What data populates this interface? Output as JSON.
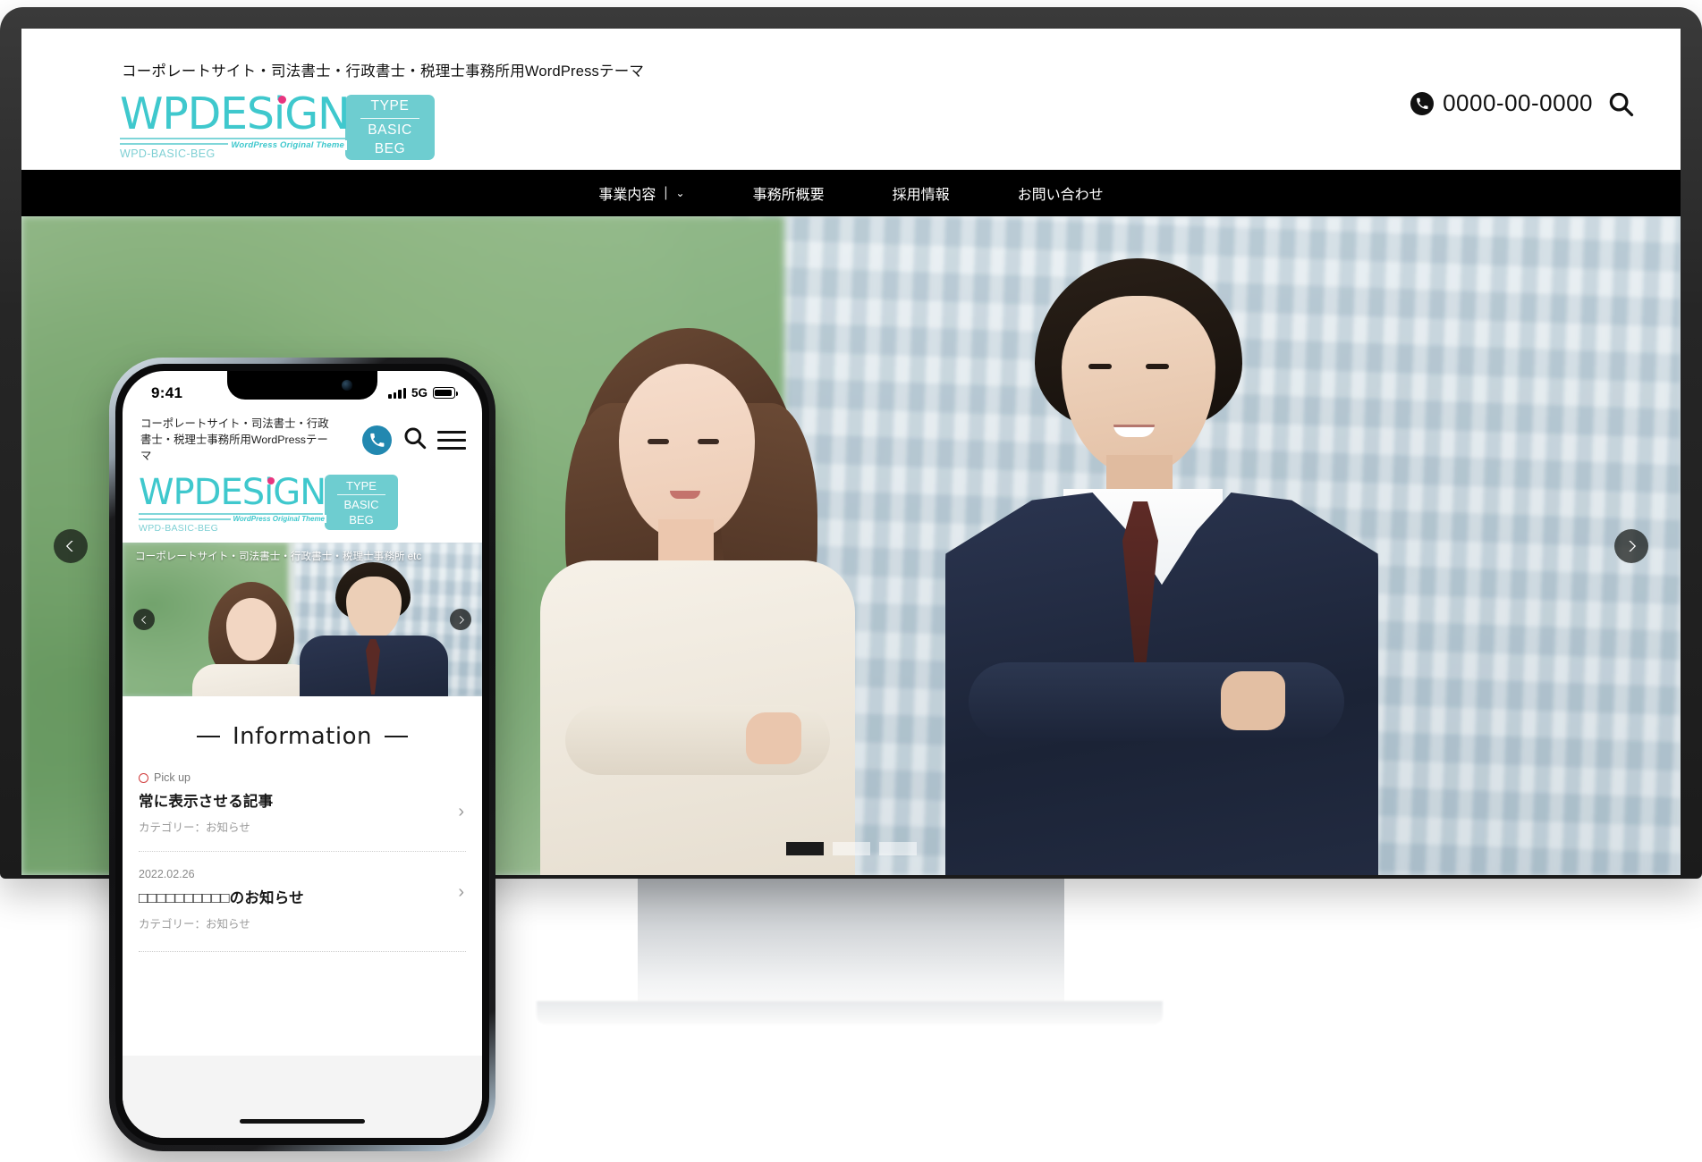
{
  "desktop": {
    "tagline": "コーポレートサイト・司法書士・行政書士・税理士事務所用WordPressテーマ",
    "logo": {
      "word_a": "WPDES",
      "word_i": "i",
      "word_b": "GN",
      "sub": "WordPress Original Theme",
      "code": "WPD-BASIC-BEG",
      "badge_type": "TYPE",
      "badge_basic": "BASIC",
      "badge_beg": "BEG"
    },
    "header": {
      "phone": "0000-00-0000",
      "phone_icon": "phone-icon",
      "search_icon": "search-icon"
    },
    "nav": [
      {
        "label": "事業内容",
        "separator": "|",
        "chevron": "⌄",
        "has_submenu": true
      },
      {
        "label": "事務所概要",
        "has_submenu": false
      },
      {
        "label": "採用情報",
        "has_submenu": false
      },
      {
        "label": "お問い合わせ",
        "has_submenu": false
      }
    ],
    "hero": {
      "prev_icon": "chevron-left-icon",
      "next_icon": "chevron-right-icon",
      "slides": 3,
      "active_slide": 1
    }
  },
  "mobile": {
    "status": {
      "time": "9:41",
      "network": "5G",
      "signal_icon": "signal-bars-icon",
      "battery_icon": "battery-icon"
    },
    "header": {
      "title": "コーポレートサイト・司法書士・行政書士・税理士事務所用WordPressテーマ",
      "phone_icon": "phone-icon",
      "search_icon": "search-icon",
      "menu_icon": "hamburger-menu-icon"
    },
    "logo": {
      "word_a": "WPDES",
      "word_i": "i",
      "word_b": "GN",
      "sub": "WordPress Original Theme",
      "code": "WPD-BASIC-BEG",
      "badge_type": "TYPE",
      "badge_basic": "BASIC",
      "badge_beg": "BEG"
    },
    "hero": {
      "caption": "コーポレートサイト・司法書士・行政書士・税理士事務所 etc",
      "prev_icon": "chevron-left-icon",
      "next_icon": "chevron-right-icon"
    },
    "information": {
      "heading": "Information",
      "items": [
        {
          "badge": "Pick up",
          "date": "",
          "title": "常に表示させる記事",
          "category": "カテゴリー：お知らせ",
          "chevron": "›"
        },
        {
          "badge": "",
          "date": "2022.02.26",
          "title": "□□□□□□□□□□のお知らせ",
          "category": "カテゴリー：お知らせ",
          "chevron": "›"
        }
      ]
    }
  },
  "colors": {
    "brand_teal": "#3fc8cd",
    "badge_teal": "#6ecdd0",
    "logo_dot_pink": "#e8357f",
    "nav_bg": "#000000",
    "mobile_phone_blue": "#2288b0",
    "pickup_red": "#d03a3a"
  }
}
